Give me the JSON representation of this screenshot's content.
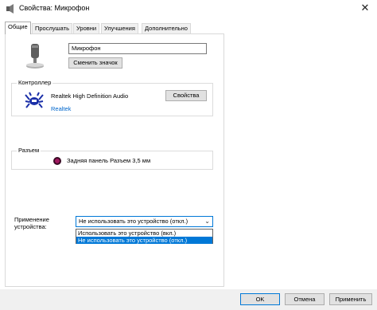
{
  "window": {
    "title": "Свойства: Микрофон"
  },
  "tabs": [
    {
      "label": "Общие"
    },
    {
      "label": "Прослушать"
    },
    {
      "label": "Уровни"
    },
    {
      "label": "Улучшения"
    },
    {
      "label": "Дополнительно"
    }
  ],
  "device": {
    "name_value": "Микрофон",
    "change_icon_label": "Сменить значок"
  },
  "controller": {
    "group_label": "Контроллер",
    "name": "Realtek High Definition Audio",
    "link": "Realtek",
    "properties_label": "Свойства"
  },
  "jack": {
    "group_label": "Разъем",
    "text": "Задняя панель Разъем 3,5 мм",
    "color": "#a0175f"
  },
  "usage": {
    "label": "Применение устройства:",
    "selected": "Не использовать это устройство (откл.)",
    "options": [
      "Использовать это устройство (вкл.)",
      "Не использовать это устройство (откл.)"
    ],
    "highlight_color": "#0078d7"
  },
  "footer": {
    "ok_label": "OK",
    "cancel_label": "Отмена",
    "apply_label": "Применить"
  }
}
